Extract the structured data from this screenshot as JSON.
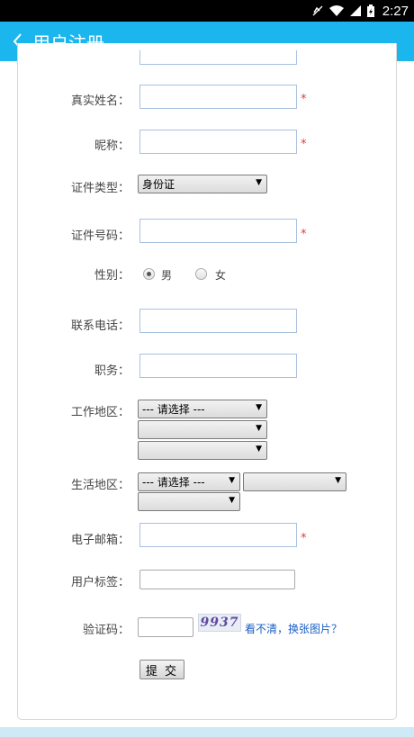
{
  "status_bar": {
    "time": "2:27"
  },
  "app_bar": {
    "title": "用户注册"
  },
  "form": {
    "real_name_label": "真实姓名：",
    "nickname_label": "昵称：",
    "id_type_label": "证件类型：",
    "id_type_value": "身份证",
    "id_number_label": "证件号码：",
    "gender_label": "性别：",
    "gender_options": [
      "男",
      "女"
    ],
    "gender_selected": "男",
    "phone_label": "联系电话：",
    "job_label": "职务：",
    "work_region_label": "工作地区：",
    "work_region_select": "--- 请选择 ---",
    "live_region_label": "生活地区：",
    "live_region_select": "--- 请选择 ---",
    "email_label": "电子邮箱：",
    "user_tag_label": "用户标签：",
    "captcha_label": "验证码：",
    "captcha_image_text": "9937",
    "captcha_refresh_link": "看不清，换张图片？",
    "required_mark": "*",
    "submit_label": "提 交"
  },
  "colors": {
    "app_bar": "#1cb6ee",
    "required": "#e4393c",
    "link": "#1a5fc6"
  }
}
